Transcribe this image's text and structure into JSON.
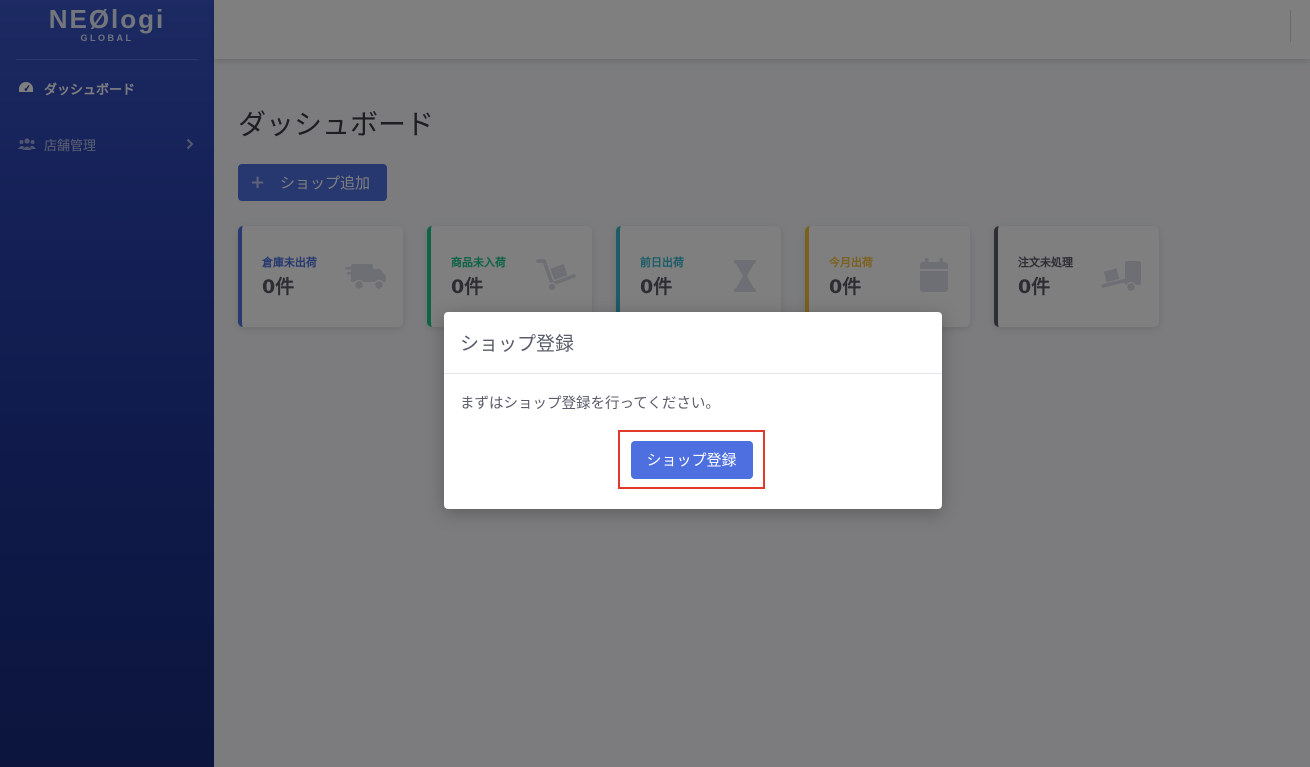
{
  "brand": {
    "name": "NEØlogi",
    "sub": "GLOBAL"
  },
  "sidebar": {
    "items": [
      {
        "label": "ダッシュボード",
        "icon": "tachometer-icon",
        "active": true
      },
      {
        "label": "店舗管理",
        "icon": "users-icon",
        "active": false
      }
    ]
  },
  "main": {
    "title": "ダッシュボード",
    "add_button": "ショップ追加",
    "cards": [
      {
        "label": "倉庫未出荷",
        "value": "0件",
        "color": "#4e73df",
        "icon": "truck-icon"
      },
      {
        "label": "商品未入荷",
        "value": "0件",
        "color": "#1cc88a",
        "icon": "dolly-icon"
      },
      {
        "label": "前日出荷",
        "value": "0件",
        "color": "#36b9cc",
        "icon": "hourglass-icon"
      },
      {
        "label": "今月出荷",
        "value": "0件",
        "color": "#f6c23e",
        "icon": "calendar-icon"
      },
      {
        "label": "注文未処理",
        "value": "0件",
        "color": "#5a5c69",
        "icon": "truck-loading-icon"
      }
    ]
  },
  "modal": {
    "title": "ショップ登録",
    "message": "まずはショップ登録を行ってください。",
    "button": "ショップ登録",
    "highlight_color": "#e13a2b"
  }
}
